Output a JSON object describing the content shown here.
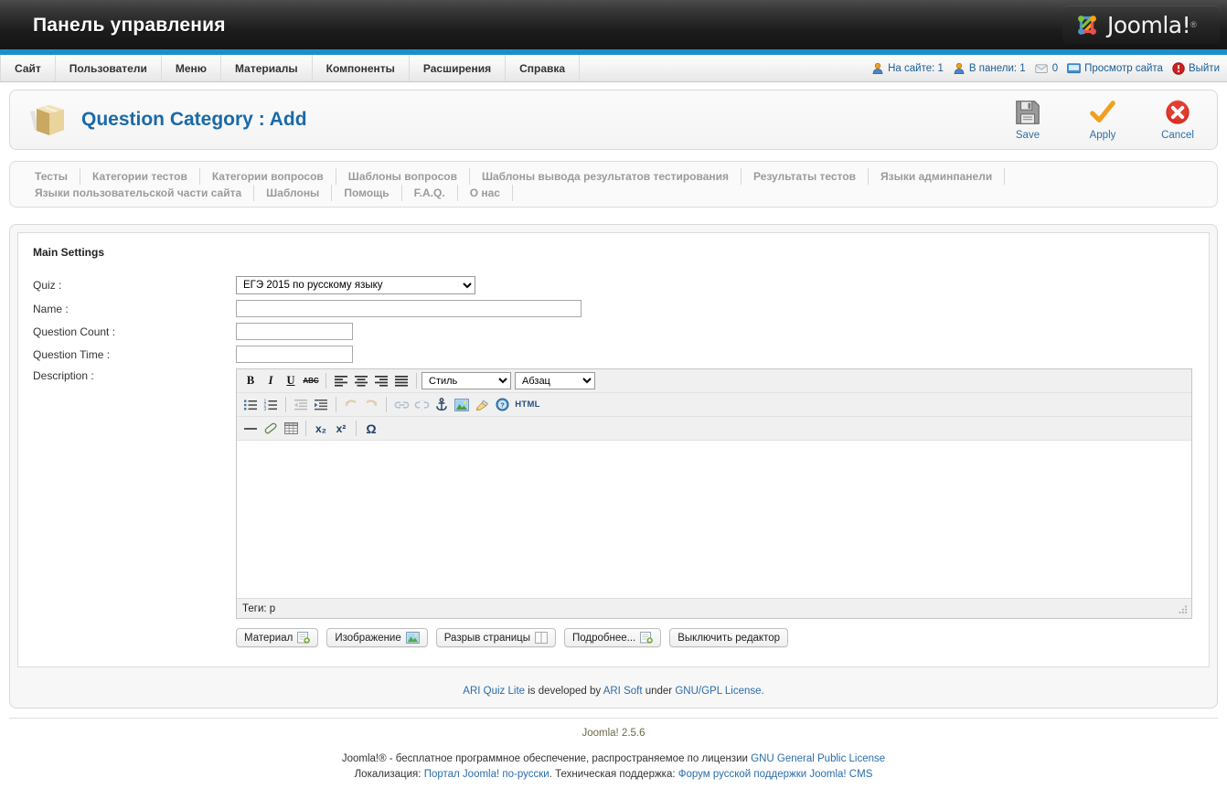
{
  "header": {
    "title": "Панель управления",
    "logo_text": "Joomla!",
    "logo_reg": "®"
  },
  "mainmenu": {
    "items": [
      {
        "label": "Сайт"
      },
      {
        "label": "Пользователи"
      },
      {
        "label": "Меню"
      },
      {
        "label": "Материалы"
      },
      {
        "label": "Компоненты"
      },
      {
        "label": "Расширения"
      },
      {
        "label": "Справка"
      }
    ]
  },
  "statusbar": {
    "visitors_label": "На сайте: 1",
    "admins_label": "В панели: 1",
    "messages_count": "0",
    "preview_label": "Просмотр сайта",
    "logout_label": "Выйти"
  },
  "page": {
    "title": "Question Category : Add",
    "icon": "box-icon"
  },
  "toolbar": {
    "buttons": [
      {
        "label": "Save",
        "icon": "floppy-disk-icon"
      },
      {
        "label": "Apply",
        "icon": "checkmark-icon"
      },
      {
        "label": "Cancel",
        "icon": "cancel-circle-icon"
      }
    ]
  },
  "submenu": {
    "tabs": [
      {
        "label": "Тесты"
      },
      {
        "label": "Категории тестов"
      },
      {
        "label": "Категории вопросов"
      },
      {
        "label": "Шаблоны вопросов"
      },
      {
        "label": "Шаблоны вывода результатов тестирования"
      },
      {
        "label": "Результаты тестов"
      },
      {
        "label": "Языки админпанели"
      },
      {
        "label": "Языки пользовательской части сайта"
      },
      {
        "label": "Шаблоны"
      },
      {
        "label": "Помощь"
      },
      {
        "label": "F.A.Q."
      },
      {
        "label": "О нас"
      }
    ]
  },
  "form": {
    "legend": "Main Settings",
    "fields": {
      "quiz": {
        "label": "Quiz :",
        "value": "ЕГЭ 2015 по русскому языку",
        "options": [
          "ЕГЭ 2015 по русскому языку"
        ]
      },
      "name": {
        "label": "Name :",
        "value": ""
      },
      "question_count": {
        "label": "Question Count :",
        "value": ""
      },
      "question_time": {
        "label": "Question Time :",
        "value": ""
      },
      "description": {
        "label": "Description :",
        "value": ""
      }
    }
  },
  "editor": {
    "row1": {
      "bold": "B",
      "italic": "I",
      "underline": "U",
      "strikethrough": "ABC",
      "align_left": "align-left-icon",
      "align_center": "align-center-icon",
      "align_right": "align-right-icon",
      "align_justify": "align-justify-icon",
      "style_select": "Стиль",
      "paragraph_select": "Абзац"
    },
    "row2": {
      "bullet_list": "bullet-list-icon",
      "numbered_list": "numbered-list-icon",
      "outdent": "outdent-icon",
      "indent": "indent-icon",
      "undo": "undo-icon",
      "redo": "redo-icon",
      "link": "link-icon",
      "unlink": "unlink-icon",
      "anchor": "anchor-icon",
      "image": "image-icon",
      "cleanup": "paintbrush-icon",
      "help": "help-icon",
      "html_label": "HTML"
    },
    "row3": {
      "hrule": "horizontal-rule-icon",
      "remove_format": "eraser-icon",
      "table": "table-icon",
      "subscript": "x₂",
      "superscript": "x²",
      "charmap": "Ω"
    },
    "status_label": "Теги: p",
    "content": ""
  },
  "editor_buttons": [
    {
      "label": "Материал",
      "icon": "article-icon"
    },
    {
      "label": "Изображение",
      "icon": "picture-icon"
    },
    {
      "label": "Разрыв страницы",
      "icon": "pagebreak-icon"
    },
    {
      "label": "Подробнее...",
      "icon": "readmore-icon"
    },
    {
      "label": "Выключить редактор",
      "icon": ""
    }
  ],
  "component_footer": {
    "link1": "ARI Quiz Lite",
    "text1": " is developed by ",
    "link2": "ARI Soft",
    "text2": " under ",
    "link3": "GNU/GPL License."
  },
  "footer": {
    "version": "Joomla! 2.5.6",
    "line1_pre": "Joomla!® - бесплатное программное обеспечение, распространяемое по лицензии ",
    "line1_link": "GNU General Public License",
    "line2_pre": "Локализация: ",
    "line2_link1": "Портал Joomla! по-русски",
    "line2_mid": ". Техническая поддержка: ",
    "line2_link2": "Форум русской поддержки Joomla! CMS"
  },
  "colors": {
    "accent_blue": "#1b8ecd",
    "link_blue": "#2b6da8",
    "title_blue": "#1a6aa8",
    "tab_gray": "#9b9b9b"
  }
}
